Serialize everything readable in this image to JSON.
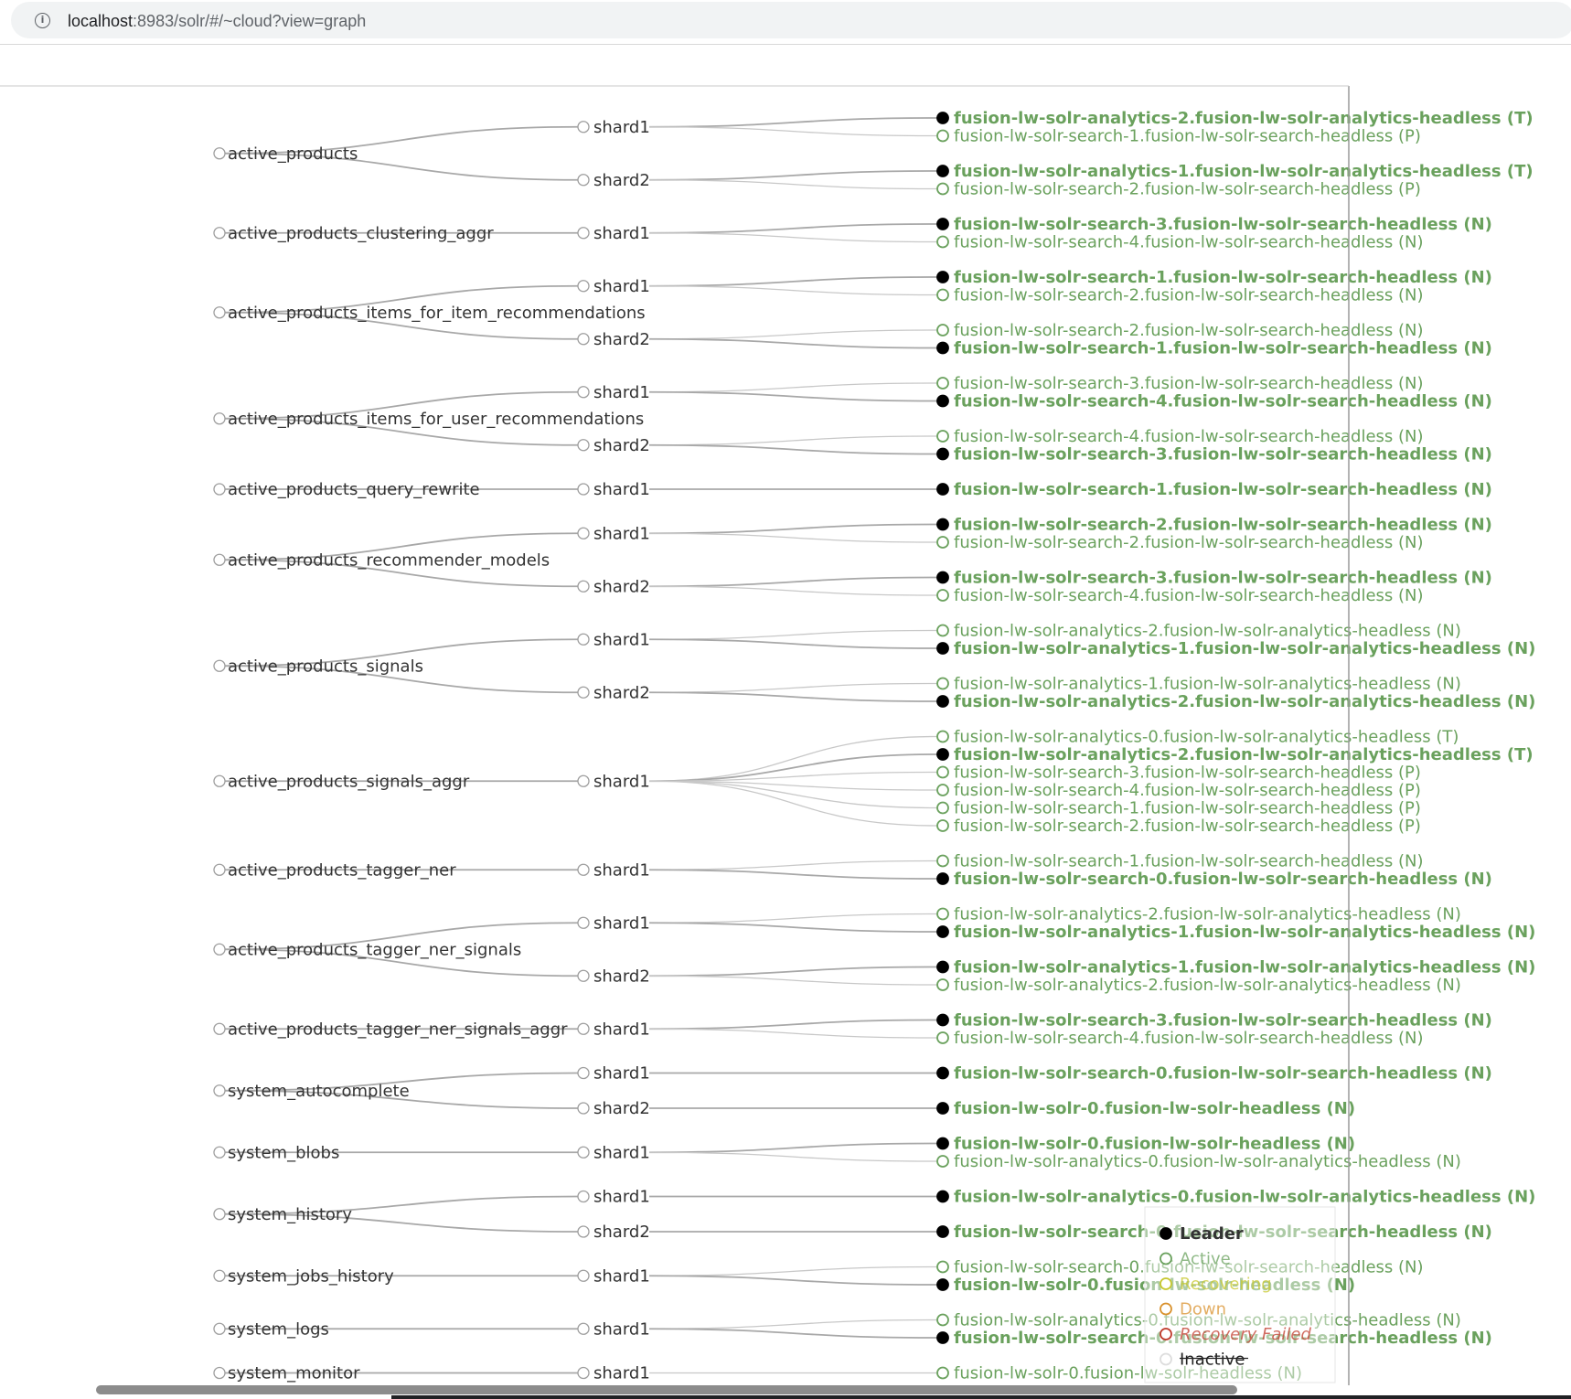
{
  "browser": {
    "url_host": "localhost",
    "url_path": ":8983/solr/#/~cloud?view=graph",
    "info_icon": "info-icon"
  },
  "legend": {
    "items": [
      {
        "label": "Leader",
        "state": "leader"
      },
      {
        "label": "Active",
        "state": "active"
      },
      {
        "label": "Recovering",
        "state": "recovering"
      },
      {
        "label": "Down",
        "state": "down"
      },
      {
        "label": "Recovery Failed",
        "state": "recovery_failed"
      },
      {
        "label": "Inactive",
        "state": "inactive"
      }
    ]
  },
  "colors": {
    "link": "#c8c8c8",
    "collection_text": "#333333",
    "node_stroke": "#9e9e9e",
    "leader_fill": "#000000",
    "active_text": "#6aa15d",
    "recovering_text": "#c8c82e",
    "down_text": "#d9922e",
    "recovery_failed_text": "#c0392b",
    "inactive_text": "#222222",
    "leader_text": "#333333"
  },
  "collections": [
    {
      "name": "active_products",
      "shards": [
        {
          "name": "shard1",
          "replicas": [
            {
              "name": "fusion-lw-solr-analytics-2.fusion-lw-solr-analytics-headless (T)",
              "leader": true
            },
            {
              "name": "fusion-lw-solr-search-1.fusion-lw-solr-search-headless (P)",
              "leader": false
            }
          ]
        },
        {
          "name": "shard2",
          "replicas": [
            {
              "name": "fusion-lw-solr-analytics-1.fusion-lw-solr-analytics-headless (T)",
              "leader": true
            },
            {
              "name": "fusion-lw-solr-search-2.fusion-lw-solr-search-headless (P)",
              "leader": false
            }
          ]
        }
      ]
    },
    {
      "name": "active_products_clustering_aggr",
      "shards": [
        {
          "name": "shard1",
          "replicas": [
            {
              "name": "fusion-lw-solr-search-3.fusion-lw-solr-search-headless (N)",
              "leader": true
            },
            {
              "name": "fusion-lw-solr-search-4.fusion-lw-solr-search-headless (N)",
              "leader": false
            }
          ]
        }
      ]
    },
    {
      "name": "active_products_items_for_item_recommendations",
      "shards": [
        {
          "name": "shard1",
          "replicas": [
            {
              "name": "fusion-lw-solr-search-1.fusion-lw-solr-search-headless (N)",
              "leader": true
            },
            {
              "name": "fusion-lw-solr-search-2.fusion-lw-solr-search-headless (N)",
              "leader": false
            }
          ]
        },
        {
          "name": "shard2",
          "replicas": [
            {
              "name": "fusion-lw-solr-search-2.fusion-lw-solr-search-headless (N)",
              "leader": false
            },
            {
              "name": "fusion-lw-solr-search-1.fusion-lw-solr-search-headless (N)",
              "leader": true
            }
          ]
        }
      ]
    },
    {
      "name": "active_products_items_for_user_recommendations",
      "shards": [
        {
          "name": "shard1",
          "replicas": [
            {
              "name": "fusion-lw-solr-search-3.fusion-lw-solr-search-headless (N)",
              "leader": false
            },
            {
              "name": "fusion-lw-solr-search-4.fusion-lw-solr-search-headless (N)",
              "leader": true
            }
          ]
        },
        {
          "name": "shard2",
          "replicas": [
            {
              "name": "fusion-lw-solr-search-4.fusion-lw-solr-search-headless (N)",
              "leader": false
            },
            {
              "name": "fusion-lw-solr-search-3.fusion-lw-solr-search-headless (N)",
              "leader": true
            }
          ]
        }
      ]
    },
    {
      "name": "active_products_query_rewrite",
      "shards": [
        {
          "name": "shard1",
          "replicas": [
            {
              "name": "fusion-lw-solr-search-1.fusion-lw-solr-search-headless (N)",
              "leader": true
            }
          ]
        }
      ]
    },
    {
      "name": "active_products_recommender_models",
      "shards": [
        {
          "name": "shard1",
          "replicas": [
            {
              "name": "fusion-lw-solr-search-2.fusion-lw-solr-search-headless (N)",
              "leader": true
            },
            {
              "name": "fusion-lw-solr-search-2.fusion-lw-solr-search-headless (N)",
              "leader": false
            }
          ]
        },
        {
          "name": "shard2",
          "replicas": [
            {
              "name": "fusion-lw-solr-search-3.fusion-lw-solr-search-headless (N)",
              "leader": true
            },
            {
              "name": "fusion-lw-solr-search-4.fusion-lw-solr-search-headless (N)",
              "leader": false
            }
          ]
        }
      ]
    },
    {
      "name": "active_products_signals",
      "shards": [
        {
          "name": "shard1",
          "replicas": [
            {
              "name": "fusion-lw-solr-analytics-2.fusion-lw-solr-analytics-headless (N)",
              "leader": false
            },
            {
              "name": "fusion-lw-solr-analytics-1.fusion-lw-solr-analytics-headless (N)",
              "leader": true
            }
          ]
        },
        {
          "name": "shard2",
          "replicas": [
            {
              "name": "fusion-lw-solr-analytics-1.fusion-lw-solr-analytics-headless (N)",
              "leader": false
            },
            {
              "name": "fusion-lw-solr-analytics-2.fusion-lw-solr-analytics-headless (N)",
              "leader": true
            }
          ]
        }
      ]
    },
    {
      "name": "active_products_signals_aggr",
      "shards": [
        {
          "name": "shard1",
          "replicas": [
            {
              "name": "fusion-lw-solr-analytics-0.fusion-lw-solr-analytics-headless (T)",
              "leader": false
            },
            {
              "name": "fusion-lw-solr-analytics-2.fusion-lw-solr-analytics-headless (T)",
              "leader": true
            },
            {
              "name": "fusion-lw-solr-search-3.fusion-lw-solr-search-headless (P)",
              "leader": false
            },
            {
              "name": "fusion-lw-solr-search-4.fusion-lw-solr-search-headless (P)",
              "leader": false
            },
            {
              "name": "fusion-lw-solr-search-1.fusion-lw-solr-search-headless (P)",
              "leader": false
            },
            {
              "name": "fusion-lw-solr-search-2.fusion-lw-solr-search-headless (P)",
              "leader": false
            }
          ]
        }
      ]
    },
    {
      "name": "active_products_tagger_ner",
      "shards": [
        {
          "name": "shard1",
          "replicas": [
            {
              "name": "fusion-lw-solr-search-1.fusion-lw-solr-search-headless (N)",
              "leader": false
            },
            {
              "name": "fusion-lw-solr-search-0.fusion-lw-solr-search-headless (N)",
              "leader": true
            }
          ]
        }
      ]
    },
    {
      "name": "active_products_tagger_ner_signals",
      "shards": [
        {
          "name": "shard1",
          "replicas": [
            {
              "name": "fusion-lw-solr-analytics-2.fusion-lw-solr-analytics-headless (N)",
              "leader": false
            },
            {
              "name": "fusion-lw-solr-analytics-1.fusion-lw-solr-analytics-headless (N)",
              "leader": true
            }
          ]
        },
        {
          "name": "shard2",
          "replicas": [
            {
              "name": "fusion-lw-solr-analytics-1.fusion-lw-solr-analytics-headless (N)",
              "leader": true
            },
            {
              "name": "fusion-lw-solr-analytics-2.fusion-lw-solr-analytics-headless (N)",
              "leader": false
            }
          ]
        }
      ]
    },
    {
      "name": "active_products_tagger_ner_signals_aggr",
      "shards": [
        {
          "name": "shard1",
          "replicas": [
            {
              "name": "fusion-lw-solr-search-3.fusion-lw-solr-search-headless (N)",
              "leader": true
            },
            {
              "name": "fusion-lw-solr-search-4.fusion-lw-solr-search-headless (N)",
              "leader": false
            }
          ]
        }
      ]
    },
    {
      "name": "system_autocomplete",
      "shards": [
        {
          "name": "shard1",
          "replicas": [
            {
              "name": "fusion-lw-solr-search-0.fusion-lw-solr-search-headless (N)",
              "leader": true
            }
          ]
        },
        {
          "name": "shard2",
          "replicas": [
            {
              "name": "fusion-lw-solr-0.fusion-lw-solr-headless (N)",
              "leader": true
            }
          ]
        }
      ]
    },
    {
      "name": "system_blobs",
      "shards": [
        {
          "name": "shard1",
          "replicas": [
            {
              "name": "fusion-lw-solr-0.fusion-lw-solr-headless (N)",
              "leader": true
            },
            {
              "name": "fusion-lw-solr-analytics-0.fusion-lw-solr-analytics-headless (N)",
              "leader": false
            }
          ]
        }
      ]
    },
    {
      "name": "system_history",
      "shards": [
        {
          "name": "shard1",
          "replicas": [
            {
              "name": "fusion-lw-solr-analytics-0.fusion-lw-solr-analytics-headless (N)",
              "leader": true
            }
          ]
        },
        {
          "name": "shard2",
          "replicas": [
            {
              "name": "fusion-lw-solr-search-0.fusion-lw-solr-search-headless (N)",
              "leader": true
            }
          ]
        }
      ]
    },
    {
      "name": "system_jobs_history",
      "shards": [
        {
          "name": "shard1",
          "replicas": [
            {
              "name": "fusion-lw-solr-search-0.fusion-lw-solr-search-headless (N)",
              "leader": false
            },
            {
              "name": "fusion-lw-solr-0.fusion-lw-solr-headless (N)",
              "leader": true
            }
          ]
        }
      ]
    },
    {
      "name": "system_logs",
      "shards": [
        {
          "name": "shard1",
          "replicas": [
            {
              "name": "fusion-lw-solr-analytics-0.fusion-lw-solr-analytics-headless (N)",
              "leader": false
            },
            {
              "name": "fusion-lw-solr-search-0.fusion-lw-solr-search-headless (N)",
              "leader": true
            }
          ]
        }
      ]
    },
    {
      "name": "system_monitor",
      "shards": [
        {
          "name": "shard1",
          "replicas": [
            {
              "name": "fusion-lw-solr-0.fusion-lw-solr-headless (N)",
              "leader": false
            }
          ]
        }
      ]
    }
  ]
}
